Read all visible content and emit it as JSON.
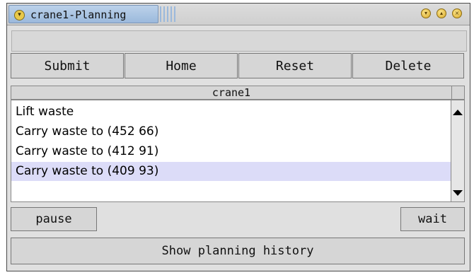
{
  "window": {
    "title": "crane1-Planning",
    "menu_glyph": "▾",
    "controls": [
      {
        "name": "minimize-control",
        "glyph": "▾"
      },
      {
        "name": "maximize-control",
        "glyph": "▴"
      },
      {
        "name": "close-control",
        "glyph": "×"
      }
    ]
  },
  "toolbar": {
    "submit_label": "Submit",
    "home_label": "Home",
    "reset_label": "Reset",
    "delete_label": "Delete"
  },
  "list": {
    "header": "crane1",
    "items": [
      {
        "label": "Lift waste",
        "selected": false
      },
      {
        "label": "Carry waste to (452 66)",
        "selected": false
      },
      {
        "label": "Carry waste to (412 91)",
        "selected": false
      },
      {
        "label": "Carry waste to (409 93)",
        "selected": true
      }
    ]
  },
  "bottom": {
    "pause_label": "pause",
    "wait_label": "wait",
    "history_label": "Show planning history"
  }
}
